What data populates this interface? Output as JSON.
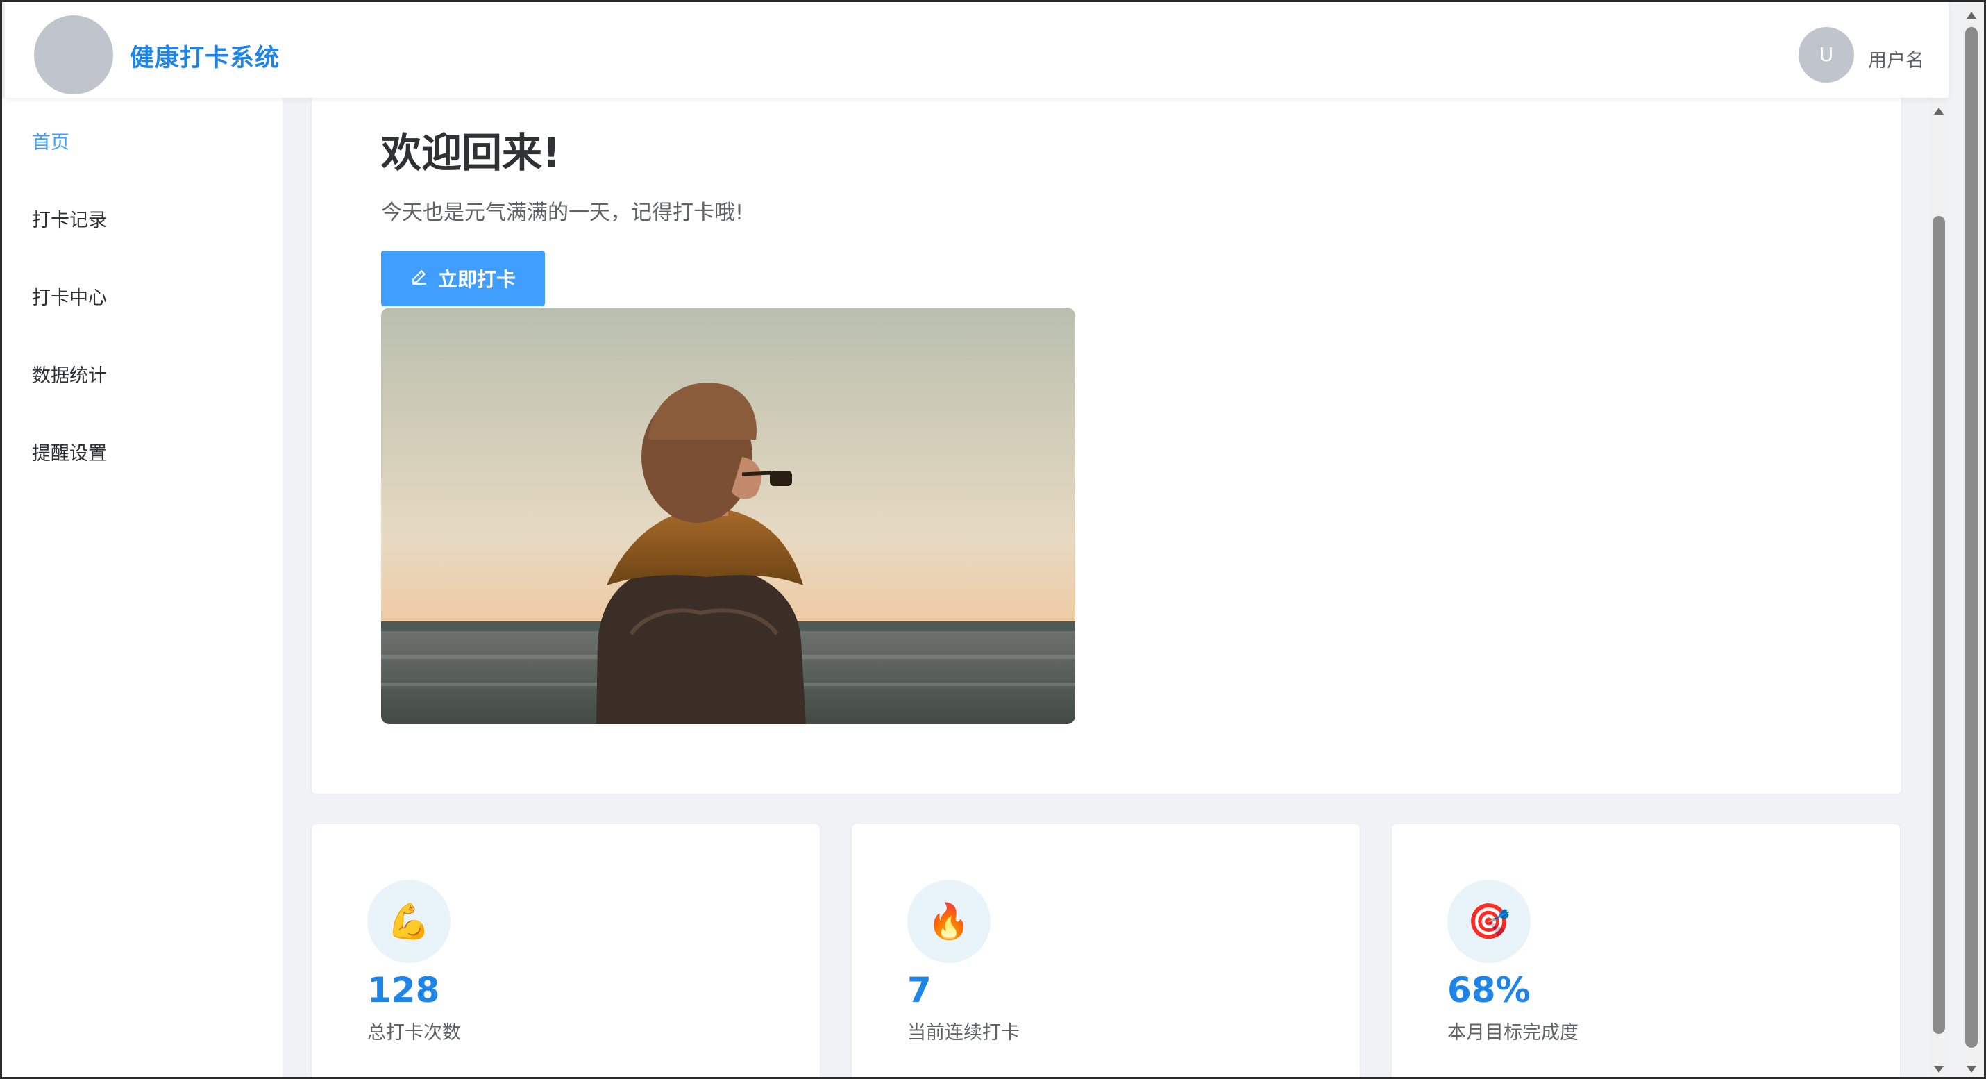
{
  "header": {
    "app_title": "健康打卡系统",
    "user_avatar_letter": "U",
    "user_name": "用户名"
  },
  "sidebar": {
    "items": [
      {
        "label": "首页",
        "active": true
      },
      {
        "label": "打卡记录",
        "active": false
      },
      {
        "label": "打卡中心",
        "active": false
      },
      {
        "label": "数据统计",
        "active": false
      },
      {
        "label": "提醒设置",
        "active": false
      }
    ]
  },
  "welcome": {
    "title": "欢迎回来!",
    "subtitle": "今天也是元气满满的一天，记得打卡哦!",
    "button_label": "立即打卡",
    "button_icon": "edit-pen-icon"
  },
  "stats": [
    {
      "icon": "flexed-biceps-icon",
      "value": "128",
      "label": "总打卡次数"
    },
    {
      "icon": "fire-icon",
      "value": "7",
      "label": "当前连续打卡"
    },
    {
      "icon": "target-icon",
      "value": "68%",
      "label": "本月目标完成度"
    }
  ],
  "colors": {
    "accent": "#409eff",
    "title_blue": "#1f84e8",
    "page_bg": "#f0f2f5"
  }
}
